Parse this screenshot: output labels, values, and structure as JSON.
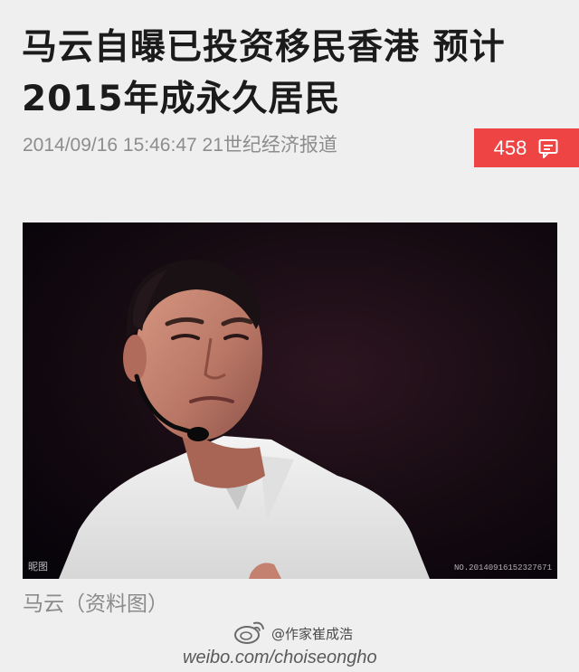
{
  "article": {
    "title": "马云自曝已投资移民香港 预计2015年成永久居民",
    "timestamp": "2014/09/16 15:46:47",
    "source": "21世纪经济报道",
    "comment_count": "458",
    "comment_icon": "comment-bubble-icon"
  },
  "image": {
    "description_subject": "man in white shirt with headset microphone",
    "credit_text": "昵图",
    "serial_text": "NO.20140916152327671",
    "caption": "马云（资料图）"
  },
  "watermark": {
    "handle": "@作家崔成浩",
    "url": "weibo.com/choiseongho"
  },
  "colors": {
    "badge_red": "#ee4444",
    "title_text": "#1b1b1b",
    "meta_text": "#8d8d8d",
    "background": "#efefef"
  }
}
